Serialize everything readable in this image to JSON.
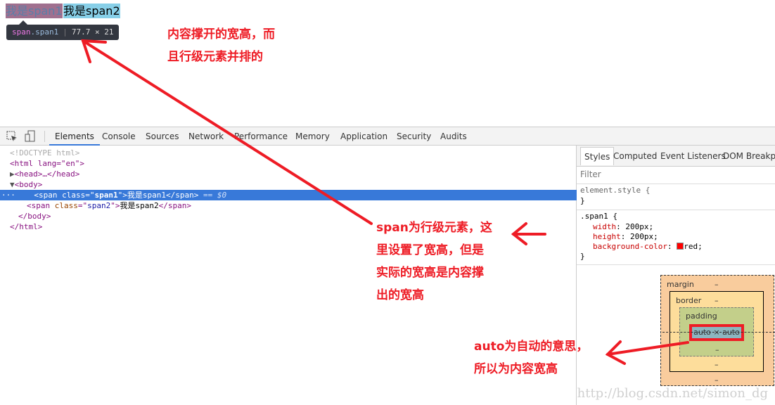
{
  "page": {
    "span1": "我是span1",
    "span2": "我是span2"
  },
  "tooltip": {
    "tag": "span",
    "cls": ".span1",
    "size": "77.7 × 21"
  },
  "annotations": {
    "a1_l1": "内容撑开的宽高，而",
    "a1_l2": "且行级元素并排的",
    "a2_l1": "span为行级元素，这",
    "a2_l2": "里设置了宽高，但是",
    "a2_l3": "实际的宽高是内容撑",
    "a2_l4": "出的宽高",
    "a3_l1": "auto为自动的意思，",
    "a3_l2": "所以为内容宽高",
    "color": "#ee1c25"
  },
  "devtools": {
    "tabs": [
      "Elements",
      "Console",
      "Sources",
      "Network",
      "Performance",
      "Memory",
      "Application",
      "Security",
      "Audits"
    ],
    "active_tab": "Elements",
    "dom": {
      "doctype": "<!DOCTYPE html>",
      "html_open": "<html lang=\"en\">",
      "head": "<head>…</head>",
      "body_open": "<body>",
      "span1_attr": "span1",
      "span1_text": "我是span1",
      "sel_suffix": "== $0",
      "span2_attr": "span2",
      "span2_text": "我是span2",
      "body_close": "</body>",
      "html_close": "</html>"
    },
    "styles": {
      "tabs": [
        "Styles",
        "Computed",
        "Event Listeners",
        "DOM Breakpo"
      ],
      "filter_placeholder": "Filter",
      "element_style": "element.style {",
      "close": "}",
      "selector": ".span1 {",
      "props": [
        {
          "name": "width",
          "value": "200px;"
        },
        {
          "name": "height",
          "value": "200px;"
        },
        {
          "name": "background-color",
          "value": "red;"
        }
      ],
      "swatch": "#ff0000"
    },
    "boxmodel": {
      "margin": "margin",
      "border": "border",
      "padding": "padding",
      "content": "auto × auto",
      "dash": "–"
    }
  },
  "watermark": "http://blog.csdn.net/simon_dg"
}
